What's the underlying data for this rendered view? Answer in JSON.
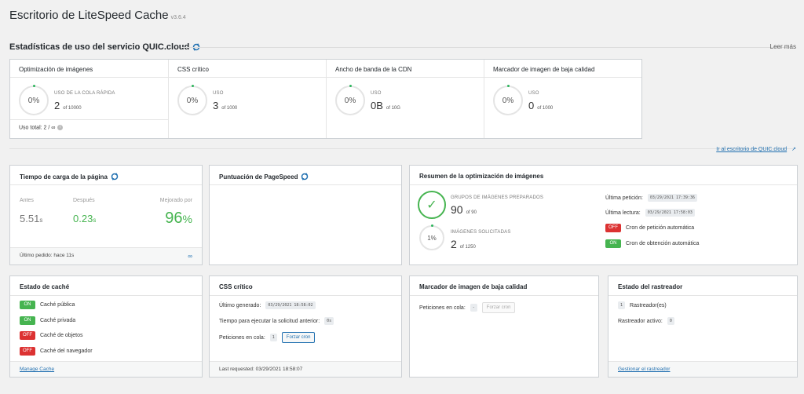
{
  "header": {
    "title": "Escritorio de LiteSpeed Cache",
    "version": "v3.6.4"
  },
  "quic_section": {
    "title": "Estadísticas de uso del servicio QUIC.cloud",
    "read_more": "Leer más",
    "dashboard_link": "Ir al escritorio de QUIC.cloud",
    "stats": [
      {
        "title": "Optimización de imágenes",
        "percent": "0%",
        "usage_label": "USO DE LA COLA RÁPIDA",
        "used": "2",
        "of": "of 10000",
        "total_label": "Uso total: 2 / ∞"
      },
      {
        "title": "CSS crítico",
        "percent": "0%",
        "usage_label": "USO",
        "used": "3",
        "of": "of 1000"
      },
      {
        "title": "Ancho de banda de la CDN",
        "percent": "0%",
        "usage_label": "USO",
        "used": "0B",
        "of": "of 10G"
      },
      {
        "title": "Marcador de imagen de baja calidad",
        "percent": "0%",
        "usage_label": "USO",
        "used": "0",
        "of": "of 1000"
      }
    ]
  },
  "page_load": {
    "title": "Tiempo de carga de la página",
    "before_label": "Antes",
    "before_value": "5.51",
    "before_unit": "s",
    "after_label": "Después",
    "after_value": "0.23",
    "after_unit": "s",
    "improved_label": "Mejorado por",
    "improved_value": "96",
    "improved_unit": "%",
    "footer": "Último pedido: hace 11s"
  },
  "pagespeed": {
    "title": "Puntuación de PageSpeed"
  },
  "img_summary": {
    "title": "Resumen de la optimización de imágenes",
    "groups_label": "GRUPOS DE IMÁGENES PREPARADOS",
    "groups_value": "90",
    "groups_of": "of 90",
    "requested_percent": "1%",
    "requested_label": "IMÁGENES SOLICITADAS",
    "requested_value": "2",
    "requested_of": "of 1250",
    "last_request_label": "Última petición:",
    "last_request_value": "03/29/2021 17:39:36",
    "last_pull_label": "Última lectura:",
    "last_pull_value": "03/29/2021 17:58:03",
    "cron_request_badge": "OFF",
    "cron_request_label": "Cron de petición automática",
    "cron_pull_badge": "ON",
    "cron_pull_label": "Cron de obtención automática"
  },
  "cache_status": {
    "title": "Estado de caché",
    "items": [
      {
        "badge": "ON",
        "label": "Caché pública"
      },
      {
        "badge": "ON",
        "label": "Caché privada"
      },
      {
        "badge": "OFF",
        "label": "Caché de objetos"
      },
      {
        "badge": "OFF",
        "label": "Caché del navegador"
      }
    ],
    "footer_link": "Manage Cache"
  },
  "ccss": {
    "title": "CSS crítico",
    "last_generated_label": "Último generado:",
    "last_generated_value": "03/29/2021 18:58:02",
    "time_label": "Tiempo para ejecutar la solicitud anterior:",
    "time_value": "0s",
    "queue_label": "Peticiones en cola:",
    "queue_value": "1",
    "force_btn": "Forzar cron",
    "footer": "Last requested: 03/29/2021 18:58:07"
  },
  "lqip": {
    "title": "Marcador de imagen de baja calidad",
    "queue_label": "Peticiones en cola:",
    "queue_value": "-",
    "force_btn": "Forzar cron"
  },
  "crawler": {
    "title": "Estado del rastreador",
    "count_value": "1",
    "count_label": "Rastreador(es)",
    "active_label": "Rastreador activo:",
    "active_value": "0",
    "footer_link": "Gestionar el rastreador"
  },
  "colors": {
    "green": "#46b450",
    "red": "#dc3232",
    "blue": "#2271b1"
  },
  "icons": [
    "sync-icon",
    "info-icon",
    "external-link-icon",
    "link-icon",
    "check-icon"
  ]
}
